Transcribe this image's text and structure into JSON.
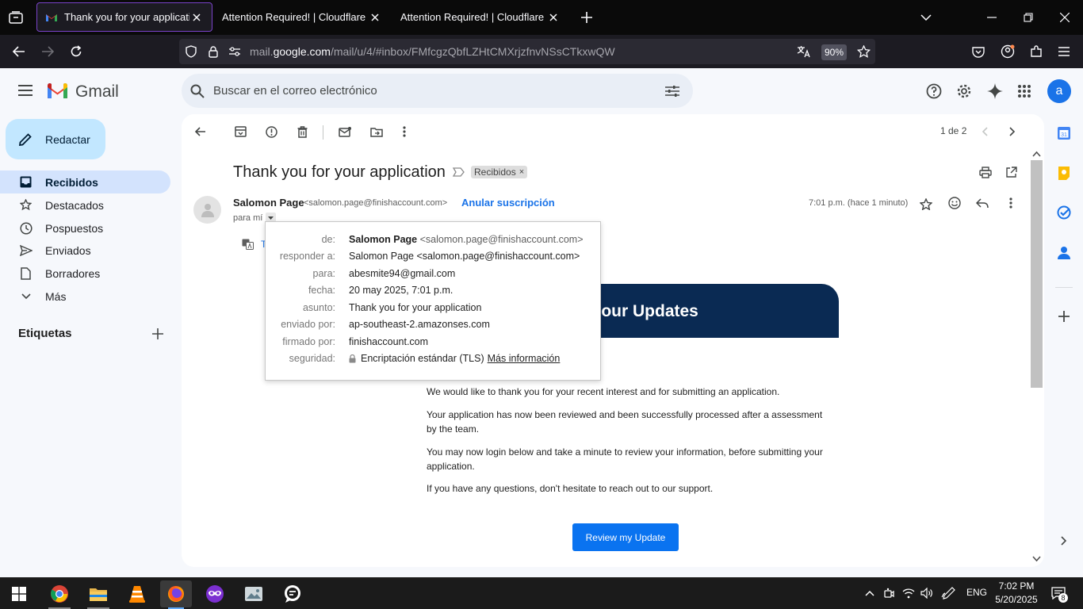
{
  "browser": {
    "tabs": [
      {
        "title": "Thank you for your application",
        "active": true
      },
      {
        "title": "Attention Required! | Cloudflare",
        "active": false
      },
      {
        "title": "Attention Required! | Cloudflare",
        "active": false
      }
    ],
    "url_prefix": "mail.",
    "url_domain": "google.com",
    "url_path": "/mail/u/4/#inbox/FMfcgzQbfLZHtCMXrjzfnvNSsCTkxwQW",
    "zoom": "90%"
  },
  "gmail": {
    "logo_text": "Gmail",
    "search_placeholder": "Buscar en el correo electrónico",
    "avatar_letter": "a",
    "compose_label": "Redactar",
    "nav": [
      {
        "label": "Recibidos",
        "icon": "inbox-icon",
        "active": true
      },
      {
        "label": "Destacados",
        "icon": "star-icon",
        "active": false
      },
      {
        "label": "Pospuestos",
        "icon": "clock-icon",
        "active": false
      },
      {
        "label": "Enviados",
        "icon": "send-icon",
        "active": false
      },
      {
        "label": "Borradores",
        "icon": "draft-icon",
        "active": false
      },
      {
        "label": "Más",
        "icon": "chevron-down-icon",
        "active": false
      }
    ],
    "labels_title": "Etiquetas",
    "pagination": "1 de 2"
  },
  "email": {
    "subject": "Thank you for your application",
    "inbox_chip": "Recibidos",
    "sender_name": "Salomon Page",
    "sender_email": "<salomon.page@finishaccount.com>",
    "unsubscribe": "Anular suscripción",
    "to_me": "para mí",
    "date": "7:01 p.m. (hace 1 minuto)",
    "translate_link": "T",
    "banner_text": "g your Updates",
    "paragraphs": [
      "We would like to thank you for your recent interest and for submitting an application.",
      "Your application has now been reviewed and been successfully processed after a assessment by the team.",
      "You may now login below and take a minute to review your information, before submitting your application.",
      "If you have any questions, don't hesitate to reach out to our support."
    ],
    "cta_label": "Review my Update"
  },
  "details": {
    "labels": {
      "from": "de:",
      "reply_to": "responder a:",
      "to": "para:",
      "date": "fecha:",
      "subject": "asunto:",
      "mailed_by": "enviado por:",
      "signed_by": "firmado por:",
      "security": "seguridad:"
    },
    "from_name": "Salomon Page",
    "from_email": "<salomon.page@finishaccount.com>",
    "reply_to": "Salomon Page <salomon.page@finishaccount.com>",
    "to": "abesmite94@gmail.com",
    "date": "20 may 2025, 7:01 p.m.",
    "subject": "Thank you for your application",
    "mailed_by": "ap-southeast-2.amazonses.com",
    "signed_by": "finishaccount.com",
    "security": "Encriptación estándar (TLS)",
    "more_info": "Más información"
  },
  "taskbar": {
    "language": "ENG",
    "time": "7:02 PM",
    "date": "5/20/2025",
    "notification_count": "8"
  },
  "colors": {
    "compose_bg": "#c2e7ff",
    "active_nav_bg": "#d3e3fd",
    "banner_bg": "#0a2a53",
    "cta_bg": "#0a73f0",
    "link_blue": "#1a73e8",
    "tab_accent": "#7a43c9"
  }
}
